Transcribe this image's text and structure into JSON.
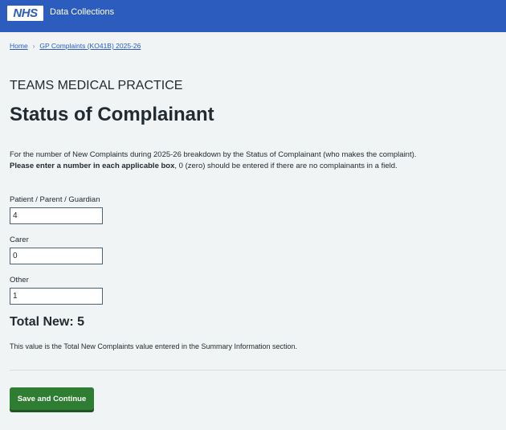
{
  "header": {
    "logo_text": "NHS",
    "service_name": "Data Collections"
  },
  "breadcrumb": {
    "items": [
      "Home",
      "GP Complaints (KO41B) 2025-26"
    ],
    "separator": "›"
  },
  "organisation": "TEAMS MEDICAL PRACTICE",
  "page_title": "Status of Complainant",
  "intro": {
    "line1": "For the number of New Complaints during 2025-26 breakdown by the Status of Complainant (who makes the complaint).",
    "line2_bold": "Please enter a number in each applicable box",
    "line2_rest": ", 0 (zero) should be entered if there are no complainants in a field."
  },
  "fields": [
    {
      "label": "Patient / Parent / Guardian",
      "value": "4"
    },
    {
      "label": "Carer",
      "value": "0"
    },
    {
      "label": "Other",
      "value": "1"
    }
  ],
  "total": {
    "text": "Total New: 5"
  },
  "note": "This value is the Total New Complaints value entered in the Summary Information section.",
  "actions": {
    "save_continue": "Save and Continue"
  },
  "colors": {
    "header_blue": "#2c5cbd",
    "page_bg": "#f0f4f5",
    "button_green": "#2e7d32",
    "link_blue": "#2c5cbd"
  }
}
